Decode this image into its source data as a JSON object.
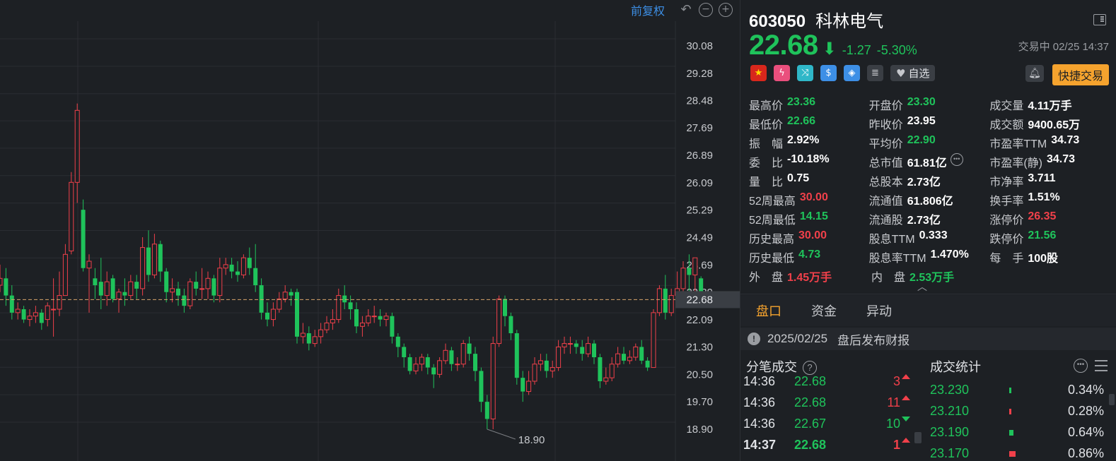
{
  "chart": {
    "price_adjust_label": "前复权",
    "y_ticks": [
      "30.08",
      "29.28",
      "28.48",
      "27.69",
      "26.89",
      "26.09",
      "25.29",
      "24.49",
      "23.69",
      "22.89",
      "22.09",
      "21.30",
      "20.50",
      "19.70",
      "18.90"
    ],
    "current_price_tag": "22.68",
    "low_marker": "18.90",
    "colors": {
      "up": "#f0404a",
      "down": "#1fc35b",
      "price_line": "#d9a56b",
      "grid": "#2a2d32"
    }
  },
  "chart_data": {
    "type": "candlestick",
    "ylim": [
      18.5,
      30.5
    ],
    "current_price": 22.68,
    "low_annotation": 18.9,
    "candles": [
      [
        23.1,
        23.3,
        23.7,
        22.9
      ],
      [
        23.3,
        22.8,
        23.6,
        22.5
      ],
      [
        22.8,
        22.3,
        23.1,
        22.1
      ],
      [
        22.3,
        22.4,
        22.6,
        22.1
      ],
      [
        22.4,
        22.1,
        22.5,
        22.0
      ],
      [
        22.1,
        22.2,
        22.4,
        21.9
      ],
      [
        22.2,
        22.3,
        22.5,
        22.0
      ],
      [
        22.3,
        22.0,
        22.4,
        21.8
      ],
      [
        22.1,
        22.5,
        22.6,
        21.9
      ],
      [
        22.4,
        22.4,
        23.3,
        21.6
      ],
      [
        22.4,
        22.8,
        23.5,
        22.2
      ],
      [
        22.8,
        24.0,
        24.3,
        22.8
      ],
      [
        24.1,
        26.1,
        26.4,
        24.0
      ],
      [
        26.1,
        28.2,
        28.4,
        25.5
      ],
      [
        25.3,
        23.6,
        25.6,
        23.5
      ],
      [
        23.6,
        23.8,
        24.0,
        22.3
      ],
      [
        23.3,
        23.1,
        23.6,
        22.7
      ],
      [
        23.2,
        22.8,
        23.9,
        22.4
      ],
      [
        22.8,
        23.2,
        23.5,
        22.5
      ],
      [
        23.3,
        22.7,
        23.4,
        22.6
      ],
      [
        22.7,
        22.9,
        23.0,
        22.3
      ],
      [
        22.9,
        22.8,
        23.3,
        22.5
      ],
      [
        22.8,
        23.2,
        23.4,
        22.7
      ],
      [
        23.2,
        23.0,
        23.4,
        22.7
      ],
      [
        23.0,
        24.2,
        24.5,
        22.8
      ],
      [
        24.2,
        23.4,
        24.7,
        23.2
      ],
      [
        23.4,
        24.3,
        24.6,
        23.3
      ],
      [
        24.3,
        23.5,
        24.4,
        23.2
      ],
      [
        23.5,
        22.9,
        23.6,
        22.6
      ],
      [
        22.9,
        23.0,
        23.3,
        22.6
      ],
      [
        23.0,
        22.8,
        23.2,
        22.5
      ],
      [
        22.8,
        22.5,
        23.0,
        22.3
      ],
      [
        22.5,
        23.2,
        23.3,
        22.4
      ],
      [
        23.2,
        23.0,
        23.5,
        22.8
      ],
      [
        23.0,
        23.0,
        23.6,
        22.7
      ],
      [
        23.0,
        23.3,
        23.5,
        22.7
      ],
      [
        23.3,
        22.8,
        23.4,
        22.6
      ],
      [
        22.8,
        23.6,
        23.9,
        22.6
      ],
      [
        23.6,
        23.7,
        23.9,
        23.4
      ],
      [
        23.7,
        23.5,
        23.9,
        23.3
      ],
      [
        23.5,
        23.4,
        23.8,
        23.2
      ],
      [
        23.4,
        23.9,
        24.0,
        23.3
      ],
      [
        23.9,
        23.6,
        24.2,
        23.4
      ],
      [
        23.6,
        23.1,
        24.3,
        22.9
      ],
      [
        23.1,
        22.3,
        23.3,
        22.1
      ],
      [
        22.3,
        22.1,
        22.6,
        21.9
      ],
      [
        22.1,
        22.4,
        22.6,
        21.9
      ],
      [
        22.4,
        22.7,
        22.9,
        22.3
      ],
      [
        22.7,
        22.9,
        23.1,
        22.6
      ],
      [
        22.9,
        22.8,
        23.0,
        22.5
      ],
      [
        22.9,
        21.6,
        23.0,
        21.4
      ],
      [
        21.6,
        21.7,
        22.0,
        21.4
      ],
      [
        21.7,
        21.4,
        21.9,
        21.2
      ],
      [
        21.4,
        21.6,
        21.8,
        21.3
      ],
      [
        21.6,
        21.8,
        22.0,
        21.4
      ],
      [
        21.8,
        22.0,
        22.2,
        21.7
      ],
      [
        22.0,
        22.1,
        22.4,
        21.8
      ],
      [
        22.1,
        22.8,
        23.0,
        22.0
      ],
      [
        22.8,
        22.6,
        23.1,
        22.4
      ],
      [
        22.6,
        22.4,
        22.8,
        22.1
      ],
      [
        22.4,
        21.9,
        22.6,
        21.7
      ],
      [
        21.9,
        22.0,
        22.2,
        21.6
      ],
      [
        22.0,
        22.2,
        22.4,
        21.9
      ],
      [
        22.2,
        22.2,
        22.5,
        22.0
      ],
      [
        22.2,
        22.1,
        22.4,
        21.9
      ],
      [
        22.1,
        22.2,
        22.3,
        21.9
      ],
      [
        22.2,
        21.6,
        22.3,
        21.4
      ],
      [
        21.6,
        21.3,
        21.7,
        21.0
      ],
      [
        21.3,
        21.0,
        21.4,
        20.7
      ],
      [
        21.0,
        20.6,
        21.1,
        20.5
      ],
      [
        20.6,
        20.8,
        21.0,
        20.5
      ],
      [
        20.8,
        21.0,
        21.1,
        20.6
      ],
      [
        21.0,
        20.7,
        21.1,
        20.5
      ],
      [
        20.7,
        20.5,
        20.8,
        20.1
      ],
      [
        20.5,
        20.9,
        21.0,
        20.4
      ],
      [
        20.9,
        21.2,
        21.4,
        20.8
      ],
      [
        21.2,
        20.8,
        21.3,
        20.6
      ],
      [
        20.8,
        20.8,
        21.0,
        20.6
      ],
      [
        20.8,
        21.4,
        21.5,
        20.7
      ],
      [
        21.4,
        21.1,
        21.6,
        20.9
      ],
      [
        21.1,
        20.6,
        21.3,
        20.3
      ],
      [
        20.6,
        19.7,
        20.7,
        19.4
      ],
      [
        19.7,
        19.2,
        19.9,
        18.9
      ],
      [
        19.2,
        21.4,
        21.6,
        18.9
      ],
      [
        21.4,
        22.7,
        22.8,
        21.3
      ],
      [
        22.7,
        22.2,
        22.8,
        21.9
      ],
      [
        22.2,
        21.7,
        22.3,
        21.5
      ],
      [
        21.7,
        20.4,
        21.8,
        20.2
      ],
      [
        20.4,
        20.0,
        20.6,
        19.7
      ],
      [
        20.0,
        20.3,
        20.6,
        19.9
      ],
      [
        20.3,
        20.8,
        21.0,
        20.2
      ],
      [
        20.8,
        20.9,
        21.1,
        20.6
      ],
      [
        20.9,
        20.6,
        21.1,
        20.4
      ],
      [
        20.6,
        20.7,
        20.9,
        20.4
      ],
      [
        20.7,
        21.3,
        21.5,
        20.6
      ],
      [
        21.3,
        21.4,
        21.6,
        21.1
      ],
      [
        21.4,
        21.4,
        21.6,
        21.1
      ],
      [
        21.4,
        21.3,
        21.5,
        21.1
      ],
      [
        21.3,
        21.1,
        21.5,
        20.9
      ],
      [
        21.1,
        21.4,
        21.6,
        21.0
      ],
      [
        21.4,
        21.0,
        21.5,
        20.8
      ],
      [
        21.0,
        20.3,
        21.1,
        20.1
      ],
      [
        20.3,
        20.4,
        20.7,
        20.2
      ],
      [
        20.4,
        20.8,
        21.0,
        20.3
      ],
      [
        20.8,
        21.1,
        21.3,
        20.7
      ],
      [
        21.1,
        20.9,
        21.3,
        20.8
      ],
      [
        20.9,
        21.0,
        21.2,
        20.8
      ],
      [
        21.0,
        21.3,
        21.4,
        20.9
      ],
      [
        21.3,
        20.9,
        21.5,
        20.8
      ],
      [
        20.9,
        20.7,
        21.0,
        20.6
      ],
      [
        20.7,
        22.3,
        22.4,
        20.7
      ],
      [
        22.3,
        23.0,
        23.1,
        22.2
      ],
      [
        23.0,
        22.3,
        23.4,
        22.1
      ],
      [
        22.3,
        22.8,
        23.0,
        22.2
      ],
      [
        22.8,
        23.0,
        23.5,
        22.7
      ],
      [
        23.0,
        23.6,
        23.8,
        22.9
      ],
      [
        23.6,
        23.4,
        24.0,
        22.8
      ],
      [
        23.4,
        23.9,
        23.9,
        22.9
      ],
      [
        23.3,
        22.68,
        23.36,
        22.66
      ]
    ]
  },
  "header": {
    "code": "603050",
    "name": "科林电气",
    "price": "22.68",
    "arrow": "⬇",
    "change": "-1.27",
    "change_pct": "-5.30%",
    "status": "交易中 02/25 14:37"
  },
  "tags": {
    "zixuan_label": "自选",
    "quick_trade_label": "快捷交易"
  },
  "stats": [
    [
      {
        "label": "最高价",
        "value": "23.36",
        "color": "green"
      },
      {
        "label": "开盘价",
        "value": "23.30",
        "color": "green"
      },
      {
        "label": "成交量",
        "value": "4.11万手",
        "color": "white"
      }
    ],
    [
      {
        "label": "最低价",
        "value": "22.66",
        "color": "green"
      },
      {
        "label": "昨收价",
        "value": "23.95",
        "color": "white"
      },
      {
        "label": "成交额",
        "value": "9400.65万",
        "color": "white"
      }
    ],
    [
      {
        "label": "振　幅",
        "value": "2.92%",
        "color": "white"
      },
      {
        "label": "平均价",
        "value": "22.90",
        "color": "green"
      },
      {
        "label": "市盈率TTM",
        "value": "34.73",
        "color": "white"
      }
    ],
    [
      {
        "label": "委　比",
        "value": "-10.18%",
        "color": "white"
      },
      {
        "label": "总市值",
        "value": "61.81亿",
        "color": "white",
        "more": true
      },
      {
        "label": "市盈率(静)",
        "value": "34.73",
        "color": "white"
      }
    ],
    [
      {
        "label": "量　比",
        "value": "0.75",
        "color": "white"
      },
      {
        "label": "总股本",
        "value": "2.73亿",
        "color": "white"
      },
      {
        "label": "市净率",
        "value": "3.711",
        "color": "white"
      }
    ],
    [
      {
        "label": "52周最高",
        "value": "30.00",
        "color": "red"
      },
      {
        "label": "流通值",
        "value": "61.806亿",
        "color": "white"
      },
      {
        "label": "换手率",
        "value": "1.51%",
        "color": "white"
      }
    ],
    [
      {
        "label": "52周最低",
        "value": "14.15",
        "color": "green"
      },
      {
        "label": "流通股",
        "value": "2.73亿",
        "color": "white"
      },
      {
        "label": "涨停价",
        "value": "26.35",
        "color": "red"
      }
    ],
    [
      {
        "label": "历史最高",
        "value": "30.00",
        "color": "red"
      },
      {
        "label": "股息TTM",
        "value": "0.333",
        "color": "white"
      },
      {
        "label": "跌停价",
        "value": "21.56",
        "color": "green"
      }
    ],
    [
      {
        "label": "历史最低",
        "value": "4.73",
        "color": "green"
      },
      {
        "label": "股息率TTM",
        "value": "1.470%",
        "color": "white"
      },
      {
        "label": "每　手",
        "value": "100股",
        "color": "white"
      }
    ],
    [
      {
        "label": "外　盘",
        "value": "1.45万手",
        "color": "red"
      },
      {
        "label": "内　盘",
        "value": "2.53万手",
        "color": "green"
      }
    ]
  ],
  "tabs": [
    "盘口",
    "资金",
    "异动"
  ],
  "notice": {
    "date": "2025/02/25",
    "text": "盘后发布财报"
  },
  "ticks_section": {
    "title": "分笔成交",
    "rows": [
      {
        "time": "14:36",
        "price": "22.68",
        "vol": "3",
        "dir": "up"
      },
      {
        "time": "14:36",
        "price": "22.68",
        "vol": "11",
        "dir": "up"
      },
      {
        "time": "14:36",
        "price": "22.67",
        "vol": "10",
        "dir": "down"
      },
      {
        "time": "14:37",
        "price": "22.68",
        "vol": "1",
        "dir": "up"
      }
    ]
  },
  "volume_stats": {
    "title": "成交统计",
    "rows": [
      {
        "price": "23.230",
        "pct": "0.34%",
        "bar": 0.34,
        "bar_color": "#1fc35b"
      },
      {
        "price": "23.210",
        "pct": "0.28%",
        "bar": 0.28,
        "bar_color": "#f0404a"
      },
      {
        "price": "23.190",
        "pct": "0.64%",
        "bar": 0.64,
        "bar_color": "#1fc35b"
      },
      {
        "price": "23.170",
        "pct": "0.86%",
        "bar": 0.86,
        "bar_color": "#f0404a"
      }
    ]
  }
}
